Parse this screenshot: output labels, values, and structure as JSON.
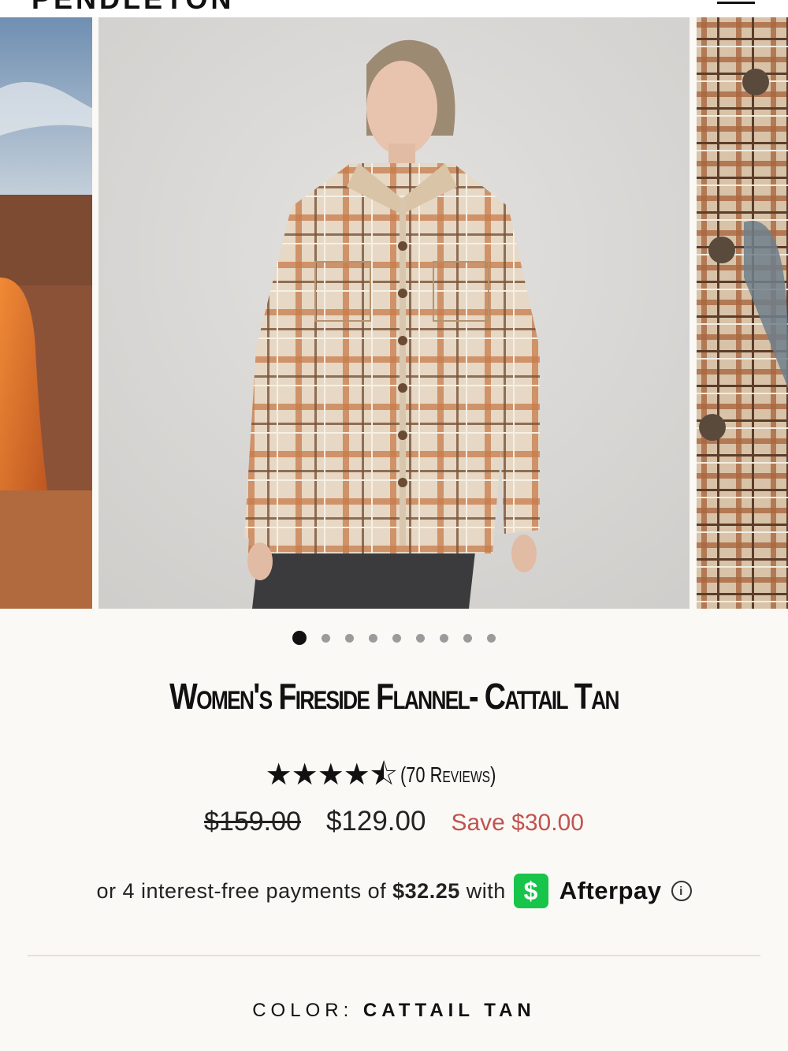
{
  "header": {
    "logo": "PENDLETON"
  },
  "gallery": {
    "slide_count": 9,
    "active_slide": 1,
    "colors": {
      "plaid_base": "#e6d8c4",
      "plaid_orange": "#c77a4a",
      "plaid_brown": "#7a5238",
      "backdrop": "#d9d8d6"
    }
  },
  "product": {
    "title": "Women's Fireside Flannel- Cattail Tan",
    "rating": 4.5,
    "stars": "★★★★⯪",
    "reviews": "(70 Reviews)",
    "price_original": "$159.00",
    "price_sale": "$129.00",
    "price_save": "Save $30.00"
  },
  "afterpay": {
    "text_before": "or 4 interest-free payments of",
    "amount": "$32.25",
    "text_after": "with",
    "badge": "$",
    "brand": "Afterpay",
    "info": "i"
  },
  "color": {
    "label": "COLOR:",
    "value": "CATTAIL TAN"
  }
}
